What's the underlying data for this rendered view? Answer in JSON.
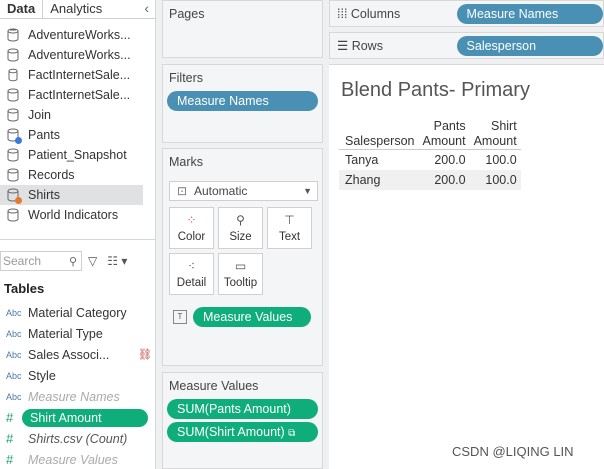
{
  "tabs": {
    "data": "Data",
    "analytics": "Analytics",
    "collapse": "‹"
  },
  "datasources": [
    {
      "name": "AdventureWorks..."
    },
    {
      "name": "AdventureWorks..."
    },
    {
      "name": "FactInternetSale..."
    },
    {
      "name": "FactInternetSale..."
    },
    {
      "name": "Join"
    },
    {
      "name": "Pants"
    },
    {
      "name": "Patient_Snapshot"
    },
    {
      "name": "Records"
    },
    {
      "name": "Shirts"
    },
    {
      "name": "World Indicators"
    }
  ],
  "search": {
    "placeholder": "Search"
  },
  "tables_heading": "Tables",
  "fields": [
    {
      "type": "Abc",
      "name": "Material Category"
    },
    {
      "type": "Abc",
      "name": "Material Type"
    },
    {
      "type": "Abc",
      "name": "Sales Associ..."
    },
    {
      "type": "Abc",
      "name": "Style"
    },
    {
      "type": "Abc",
      "name": "Measure Names"
    },
    {
      "type": "#",
      "name": "Shirt Amount"
    },
    {
      "type": "#",
      "name": "Shirts.csv (Count)"
    },
    {
      "type": "#",
      "name": "Measure Values"
    }
  ],
  "pages": {
    "title": "Pages"
  },
  "filters": {
    "title": "Filters",
    "pill": "Measure Names"
  },
  "marks": {
    "title": "Marks",
    "type": "Automatic",
    "buttons": [
      "Color",
      "Size",
      "Text",
      "Detail",
      "Tooltip"
    ],
    "measure_pill": "Measure Values",
    "mv_box": "T"
  },
  "measure_values": {
    "title": "Measure Values",
    "pills": [
      "SUM(Pants Amount)",
      "SUM(Shirt Amount)"
    ]
  },
  "columns": {
    "label": "Columns",
    "pill": "Measure Names"
  },
  "rows": {
    "label": "Rows",
    "pill": "Salesperson"
  },
  "view": {
    "title": "Blend Pants- Primary",
    "headers": {
      "row": "Salesperson",
      "c1a": "Pants",
      "c1b": "Amount",
      "c2a": "Shirt",
      "c2b": "Amount"
    },
    "rows": [
      {
        "name": "Tanya",
        "pants": "200.0",
        "shirt": "100.0"
      },
      {
        "name": "Zhang",
        "pants": "200.0",
        "shirt": "100.0"
      }
    ]
  },
  "watermark": "CSDN @LIQING LIN",
  "colors": {
    "blue_pill": "#4a90b4",
    "green_pill": "#0fad7a"
  }
}
